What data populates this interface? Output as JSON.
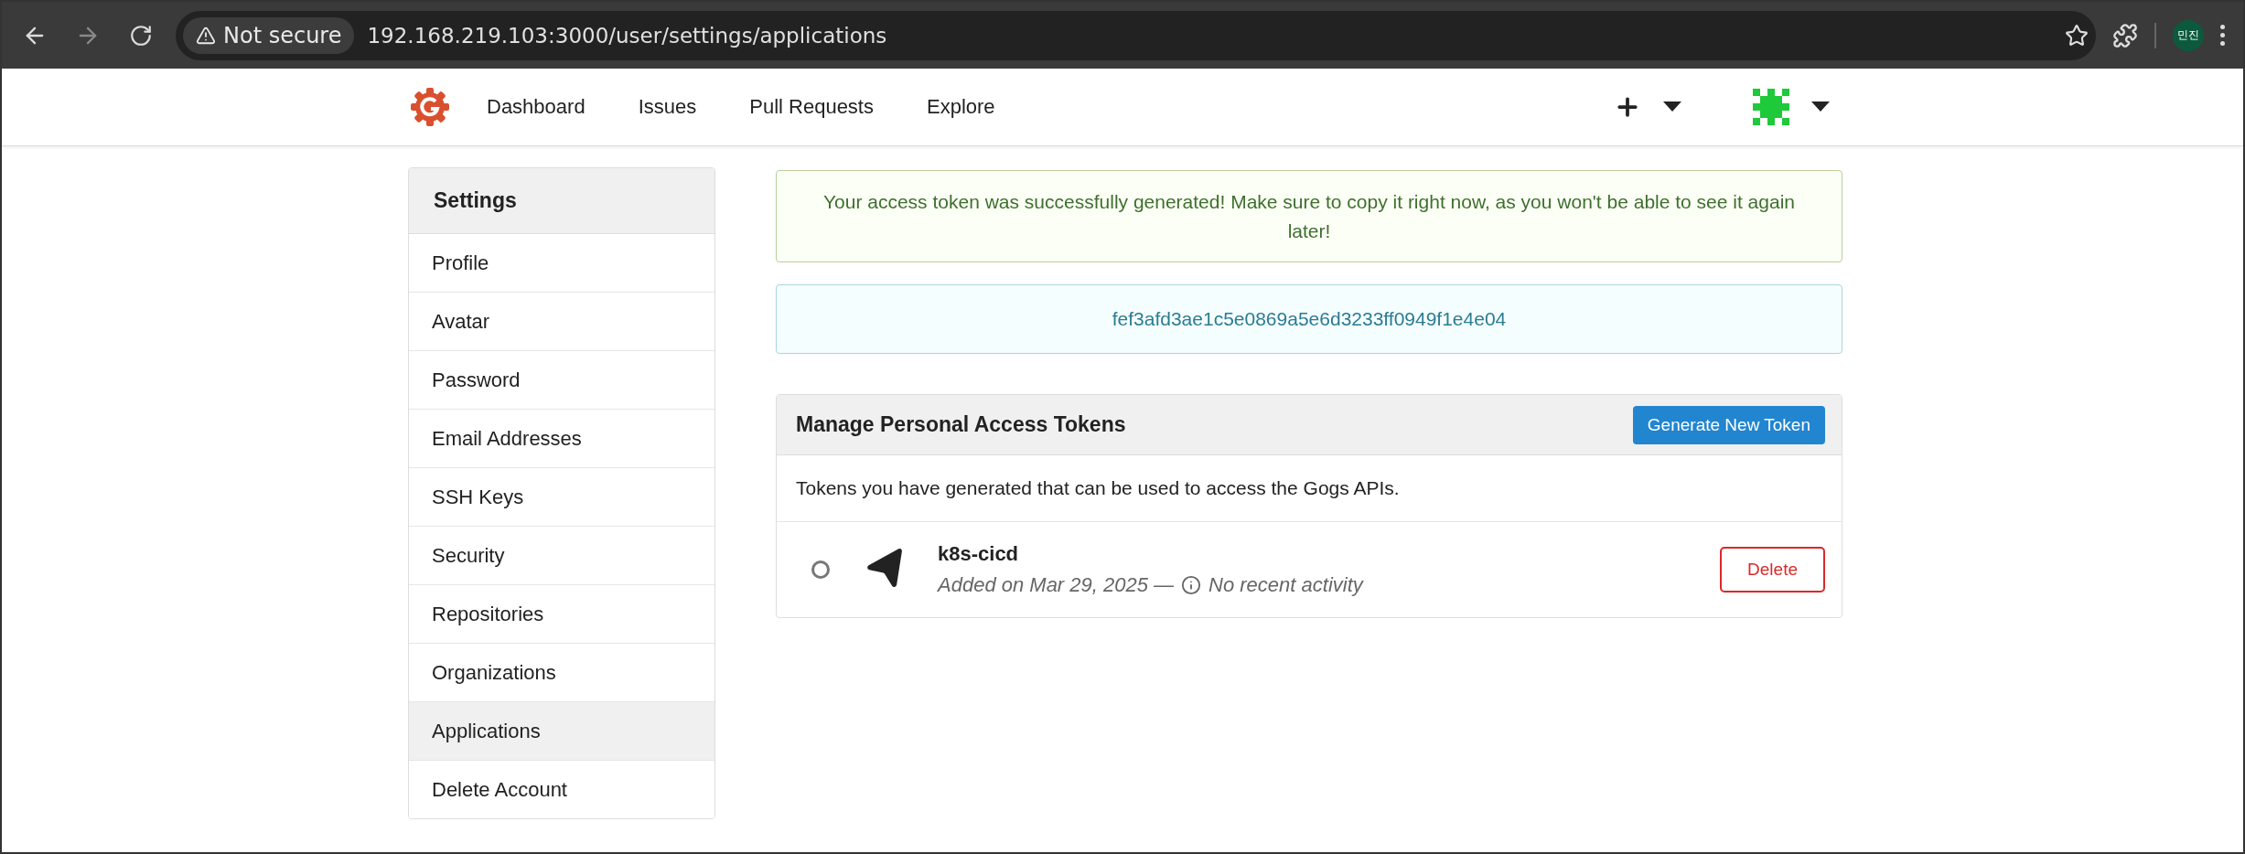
{
  "browser": {
    "security": "Not secure",
    "url": "192.168.219.103:3000/user/settings/applications",
    "profile": "민진"
  },
  "nav": {
    "items": [
      {
        "label": "Dashboard"
      },
      {
        "label": "Issues"
      },
      {
        "label": "Pull Requests"
      },
      {
        "label": "Explore"
      }
    ]
  },
  "sidebar": {
    "title": "Settings",
    "items": [
      {
        "label": "Profile",
        "selected": false
      },
      {
        "label": "Avatar",
        "selected": false
      },
      {
        "label": "Password",
        "selected": false
      },
      {
        "label": "Email Addresses",
        "selected": false
      },
      {
        "label": "SSH Keys",
        "selected": false
      },
      {
        "label": "Security",
        "selected": false
      },
      {
        "label": "Repositories",
        "selected": false
      },
      {
        "label": "Organizations",
        "selected": false
      },
      {
        "label": "Applications",
        "selected": true
      },
      {
        "label": "Delete Account",
        "selected": false
      }
    ]
  },
  "success_message": "Your access token was successfully generated! Make sure to copy it right now, as you won't be able to see it again later!",
  "token_value": "fef3afd3ae1c5e0869a5e6d3233ff0949f1e4e04",
  "panel": {
    "title": "Manage Personal Access Tokens",
    "button": "Generate New Token",
    "description": "Tokens you have generated that can be used to access the Gogs APIs.",
    "tokens": [
      {
        "name": "k8s-cicd",
        "added": "Added on Mar 29, 2025 —",
        "activity": "No recent activity",
        "active": false,
        "delete": "Delete"
      }
    ]
  }
}
